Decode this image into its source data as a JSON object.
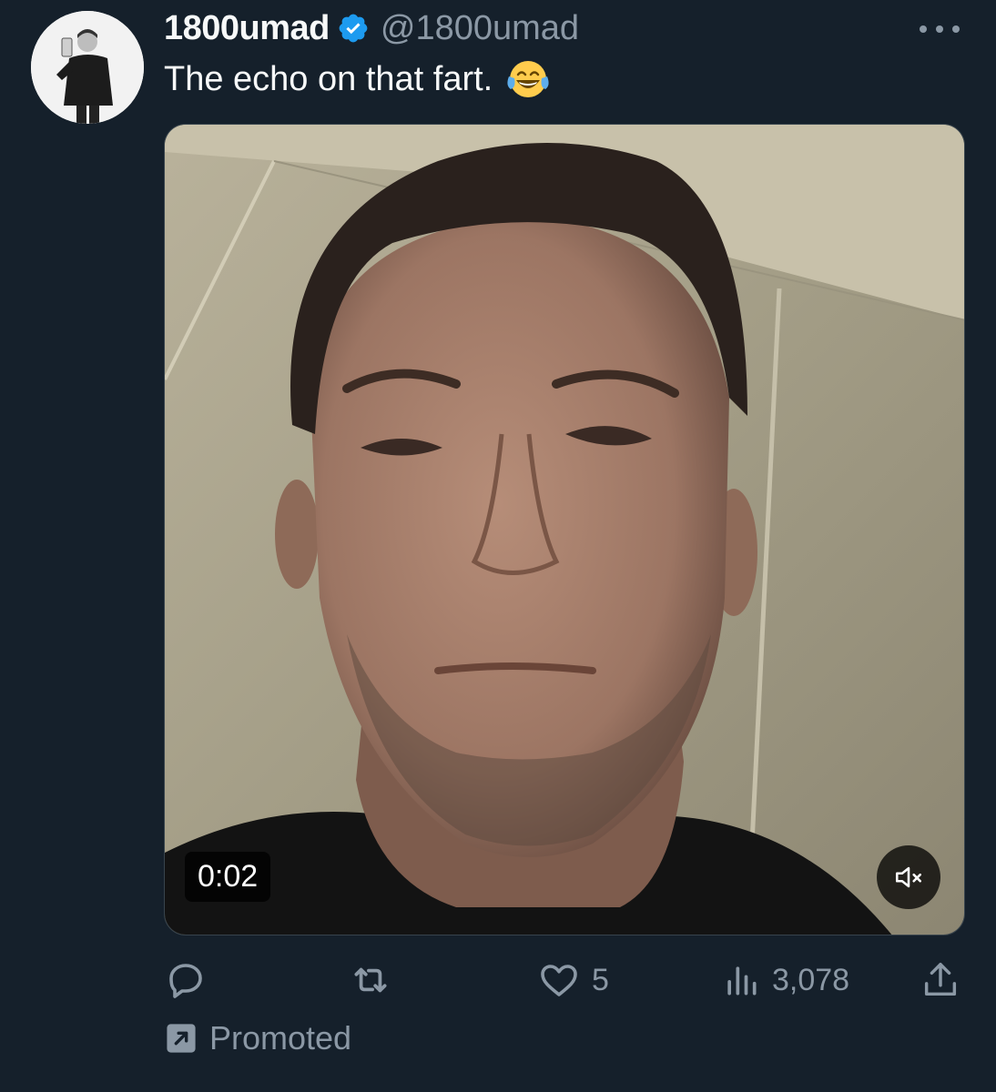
{
  "tweet": {
    "display_name": "1800umad",
    "handle": "@1800umad",
    "text": "The echo on that fart.",
    "emoji": "face-with-tears-of-joy",
    "verified_color": "#1d9bf0",
    "media": {
      "type": "video",
      "timer": "0:02",
      "muted": true
    },
    "actions": {
      "reply_count": "",
      "retweet_count": "",
      "like_count": "5",
      "views_count": "3,078"
    },
    "promoted_label": "Promoted"
  },
  "icons": {
    "more": "more-dots-icon",
    "reply": "reply-icon",
    "retweet": "retweet-icon",
    "like": "heart-icon",
    "views": "views-chart-icon",
    "share": "share-icon",
    "mute": "volume-muted-icon",
    "promoted": "promoted-arrow-icon"
  },
  "colors": {
    "background": "#15202b",
    "text_primary": "#f7f9f9",
    "text_secondary": "#8b98a5",
    "accent": "#1d9bf0"
  }
}
